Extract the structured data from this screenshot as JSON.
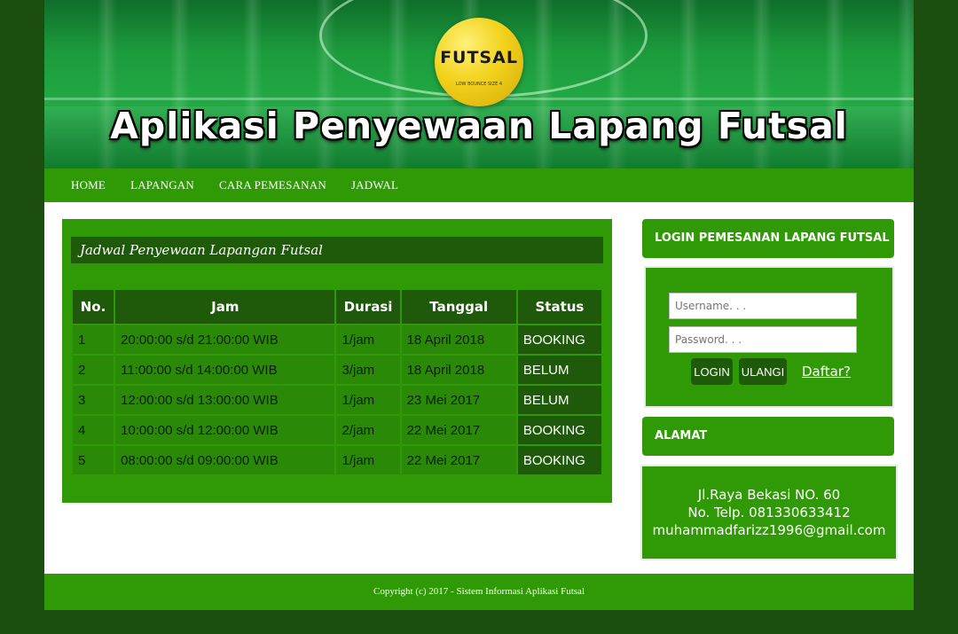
{
  "header": {
    "ball_label": "FUTSAL",
    "ball_sub": "LOW BOUNCE SIZE 4",
    "title": "Aplikasi Penyewaan Lapang Futsal"
  },
  "nav": {
    "items": [
      {
        "label": "HOME"
      },
      {
        "label": "LAPANGAN"
      },
      {
        "label": "CARA PEMESANAN"
      },
      {
        "label": "JADWAL"
      }
    ]
  },
  "schedule": {
    "title": "Jadwal Penyewaan Lapangan Futsal",
    "columns": [
      "No.",
      "Jam",
      "Durasi",
      "Tanggal",
      "Status"
    ],
    "rows": [
      {
        "no": "1",
        "jam": "20:00:00 s/d 21:00:00 WIB",
        "durasi": "1/jam",
        "tanggal": "18 April 2018",
        "status": "BOOKING"
      },
      {
        "no": "2",
        "jam": "11:00:00 s/d 14:00:00 WIB",
        "durasi": "3/jam",
        "tanggal": "18 April 2018",
        "status": "BELUM"
      },
      {
        "no": "3",
        "jam": "12:00:00 s/d 13:00:00 WIB",
        "durasi": "1/jam",
        "tanggal": "23 Mei 2017",
        "status": "BELUM"
      },
      {
        "no": "4",
        "jam": "10:00:00 s/d 12:00:00 WIB",
        "durasi": "2/jam",
        "tanggal": "22 Mei 2017",
        "status": "BOOKING"
      },
      {
        "no": "5",
        "jam": "08:00:00 s/d 09:00:00 WIB",
        "durasi": "1/jam",
        "tanggal": "22 Mei 2017",
        "status": "BOOKING"
      }
    ]
  },
  "login": {
    "heading": "LOGIN PEMESANAN LAPANG FUTSAL",
    "username_placeholder": "Username. . .",
    "password_placeholder": "Password. . .",
    "login_label": "LOGIN",
    "reset_label": "ULANGI",
    "register_label": "Daftar?"
  },
  "address": {
    "heading": "ALAMAT",
    "street": "Jl.Raya Bekasi NO. 60",
    "phone": "No. Telp. 081330633412",
    "email": "muhammadfarizz1996@gmail.com"
  },
  "footer": {
    "copyright": "Copyright (c) 2017 - Sistem Informasi Aplikasi Futsal"
  },
  "colors": {
    "page_bg": "#1b4d0e",
    "primary_green": "#2f9a05",
    "dark_green": "#1e5a0a"
  }
}
